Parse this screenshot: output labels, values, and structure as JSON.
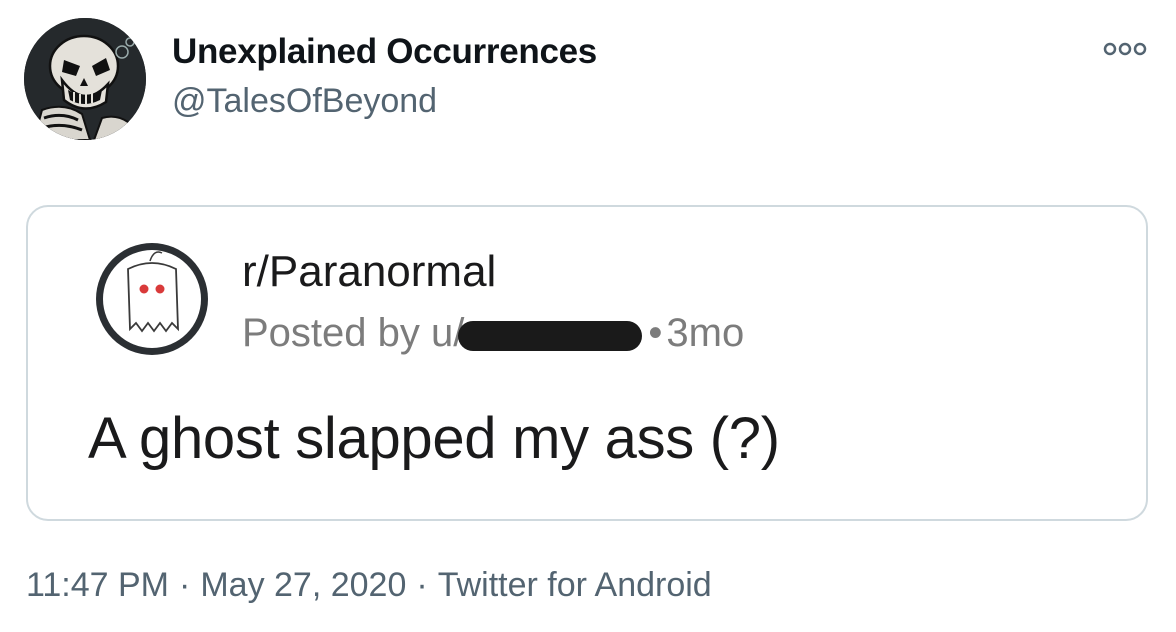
{
  "tweet": {
    "display_name": "Unexplained Occurrences",
    "handle": "@TalesOfBeyond",
    "more_icon": "more-dots-icon",
    "avatar": "skull-skeleton-avatar",
    "time": "11:47 PM",
    "separator": "·",
    "date": "May 27, 2020",
    "source": "Twitter for Android"
  },
  "embedded_post": {
    "subreddit": "r/Paranormal",
    "posted_prefix": "Posted by u/",
    "age_prefix": "• ",
    "age": "3mo",
    "title": "A ghost slapped my ass (?)",
    "redaction_color": "#1a1a1a"
  },
  "colors": {
    "text_primary": "#0f1419",
    "text_secondary": "#536471",
    "card_border": "#cfd9de",
    "ghost_eyes": "#d93a3a"
  }
}
